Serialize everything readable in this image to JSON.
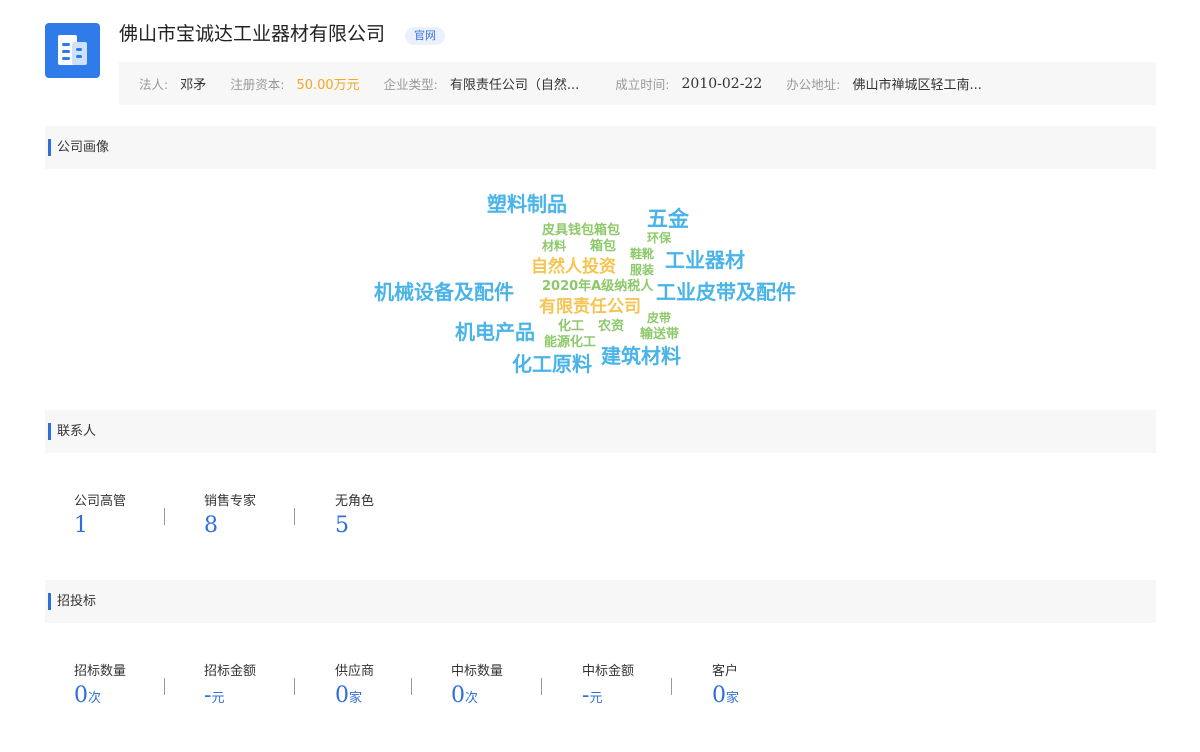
{
  "company": {
    "name": "佛山市宝诚达工业器材有限公司",
    "badge": "官网",
    "logo_icon": "building-document-icon",
    "brand_color": "#2f7bea"
  },
  "info": [
    {
      "label": "法人:",
      "value": "邓矛"
    },
    {
      "label": "注册资本:",
      "value": "50.00万元"
    },
    {
      "label": "企业类型:",
      "value": "有限责任公司（自然..."
    },
    {
      "label": "成立时间:",
      "value": "2010-02-22"
    },
    {
      "label": "办公地址:",
      "value": "佛山市禅城区轻工南..."
    }
  ],
  "sections": {
    "portrait": "公司画像",
    "contacts": "联系人",
    "bidding": "招投标"
  },
  "wordcloud": [
    {
      "text": "塑料制品",
      "color": "blue"
    },
    {
      "text": "五金",
      "color": "blue"
    },
    {
      "text": "皮具钱包箱包",
      "color": "green"
    },
    {
      "text": "环保",
      "color": "green"
    },
    {
      "text": "材料",
      "color": "green"
    },
    {
      "text": "箱包",
      "color": "green"
    },
    {
      "text": "鞋靴",
      "color": "green"
    },
    {
      "text": "自然人投资",
      "color": "orange"
    },
    {
      "text": "工业器材",
      "color": "blue"
    },
    {
      "text": "服装",
      "color": "green"
    },
    {
      "text": "机械设备及配件",
      "color": "blue"
    },
    {
      "text": "2020年A级纳税人",
      "color": "green"
    },
    {
      "text": "工业皮带及配件",
      "color": "blue"
    },
    {
      "text": "有限责任公司",
      "color": "orange"
    },
    {
      "text": "皮带",
      "color": "green"
    },
    {
      "text": "机电产品",
      "color": "blue"
    },
    {
      "text": "化工",
      "color": "green"
    },
    {
      "text": "农资",
      "color": "green"
    },
    {
      "text": "输送带",
      "color": "green"
    },
    {
      "text": "能源化工",
      "color": "green"
    },
    {
      "text": "建筑材料",
      "color": "blue"
    },
    {
      "text": "化工原料",
      "color": "blue"
    }
  ],
  "contacts": [
    {
      "label": "公司高管",
      "value": "1"
    },
    {
      "label": "销售专家",
      "value": "8"
    },
    {
      "label": "无角色",
      "value": "5"
    }
  ],
  "bidding": [
    {
      "label": "招标数量",
      "value": "0",
      "unit": "次"
    },
    {
      "label": "招标金额",
      "value": "-",
      "unit": "元"
    },
    {
      "label": "供应商",
      "value": "0",
      "unit": "家"
    },
    {
      "label": "中标数量",
      "value": "0",
      "unit": "次"
    },
    {
      "label": "中标金额",
      "value": "-",
      "unit": "元"
    },
    {
      "label": "客户",
      "value": "0",
      "unit": "家"
    }
  ],
  "colors": {
    "accent": "#2f6fdc",
    "cloud_blue": "#4ab3e8",
    "cloud_green": "#8dc96a",
    "cloud_orange": "#f4c553",
    "highlight_orange": "#f5a623"
  }
}
